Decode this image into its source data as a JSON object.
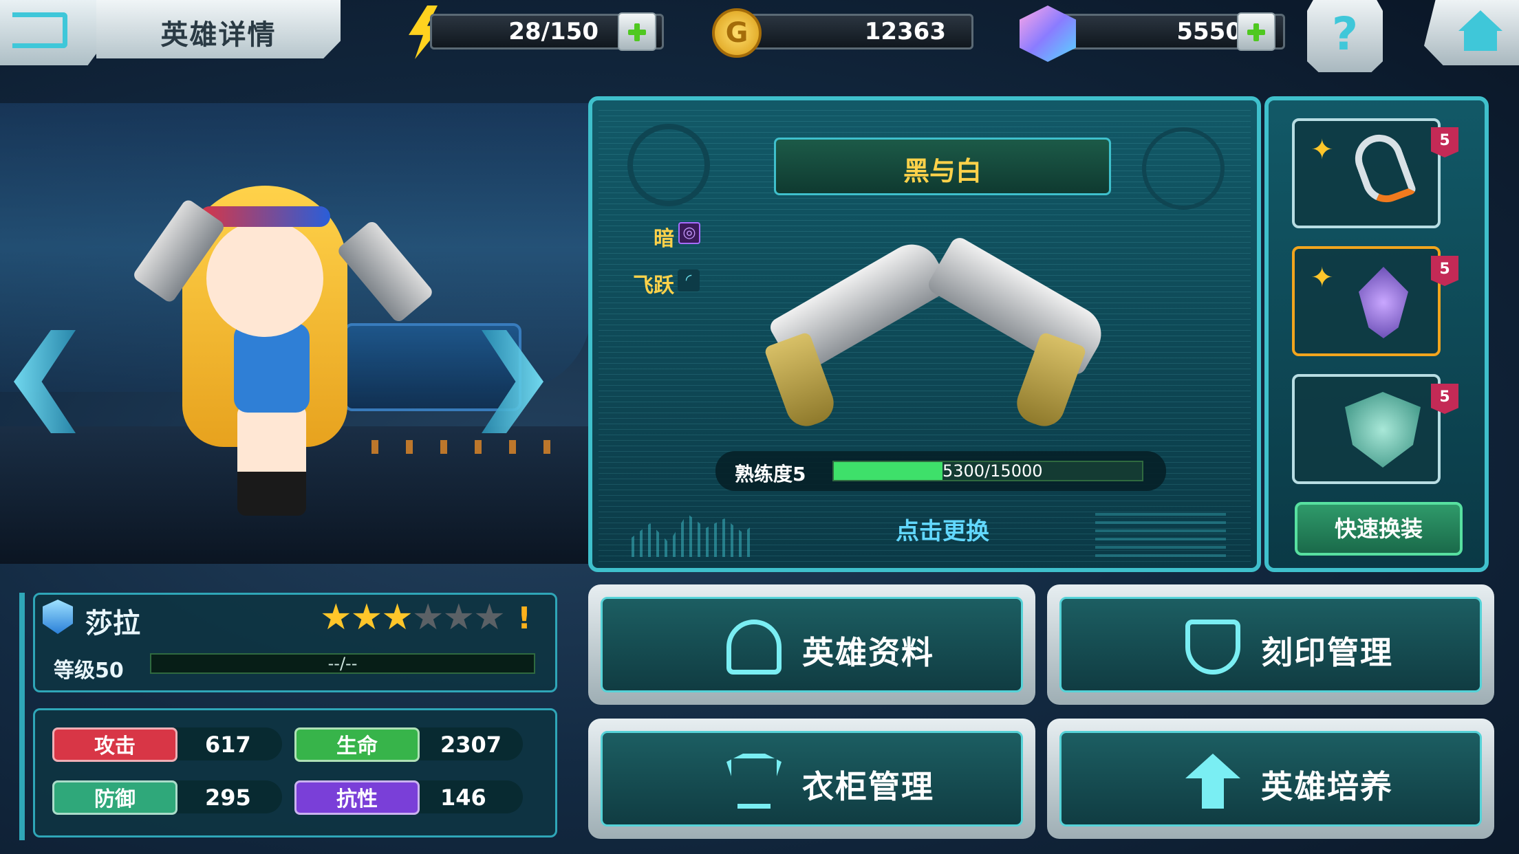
{
  "header": {
    "title": "英雄详情",
    "energy": "28/150",
    "gold": "12363",
    "gems": "5550",
    "coin_letter": "G",
    "help_glyph": "?"
  },
  "hero": {
    "name": "莎拉",
    "stars_total": 6,
    "stars_filled": 3,
    "alert": "!",
    "level_label": "等级50",
    "exp_text": "--/--"
  },
  "stats": {
    "attack_label": "攻击",
    "attack_value": "617",
    "hp_label": "生命",
    "hp_value": "2307",
    "defense_label": "防御",
    "defense_value": "295",
    "resist_label": "抗性",
    "resist_value": "146"
  },
  "weapon": {
    "name": "黑与白",
    "element_label": "暗",
    "element_icon": "dark-swirl-icon",
    "skill_label": "飞跃",
    "skill_icon": "leap-icon",
    "proficiency_label": "熟练度5",
    "proficiency_current": 5300,
    "proficiency_max": 15000,
    "proficiency_text": "5300/15000",
    "change_label": "点击更换"
  },
  "equipment": {
    "slots": [
      {
        "level": "5",
        "icon": "earpiece-icon",
        "starred": true
      },
      {
        "level": "5",
        "icon": "crystal-icon",
        "starred": true,
        "selected": true
      },
      {
        "level": "5",
        "icon": "emblem-icon",
        "starred": false
      }
    ],
    "quick_label": "快速换装"
  },
  "menu": {
    "hero_info": "英雄资料",
    "imprint": "刻印管理",
    "wardrobe": "衣柜管理",
    "training": "英雄培养"
  },
  "colors": {
    "accent": "#3fc0cc",
    "attack": "#d83646",
    "hp": "#37b44a",
    "defense": "#2fa87a",
    "resist": "#7a3fd8",
    "star": "#ffc62a"
  }
}
